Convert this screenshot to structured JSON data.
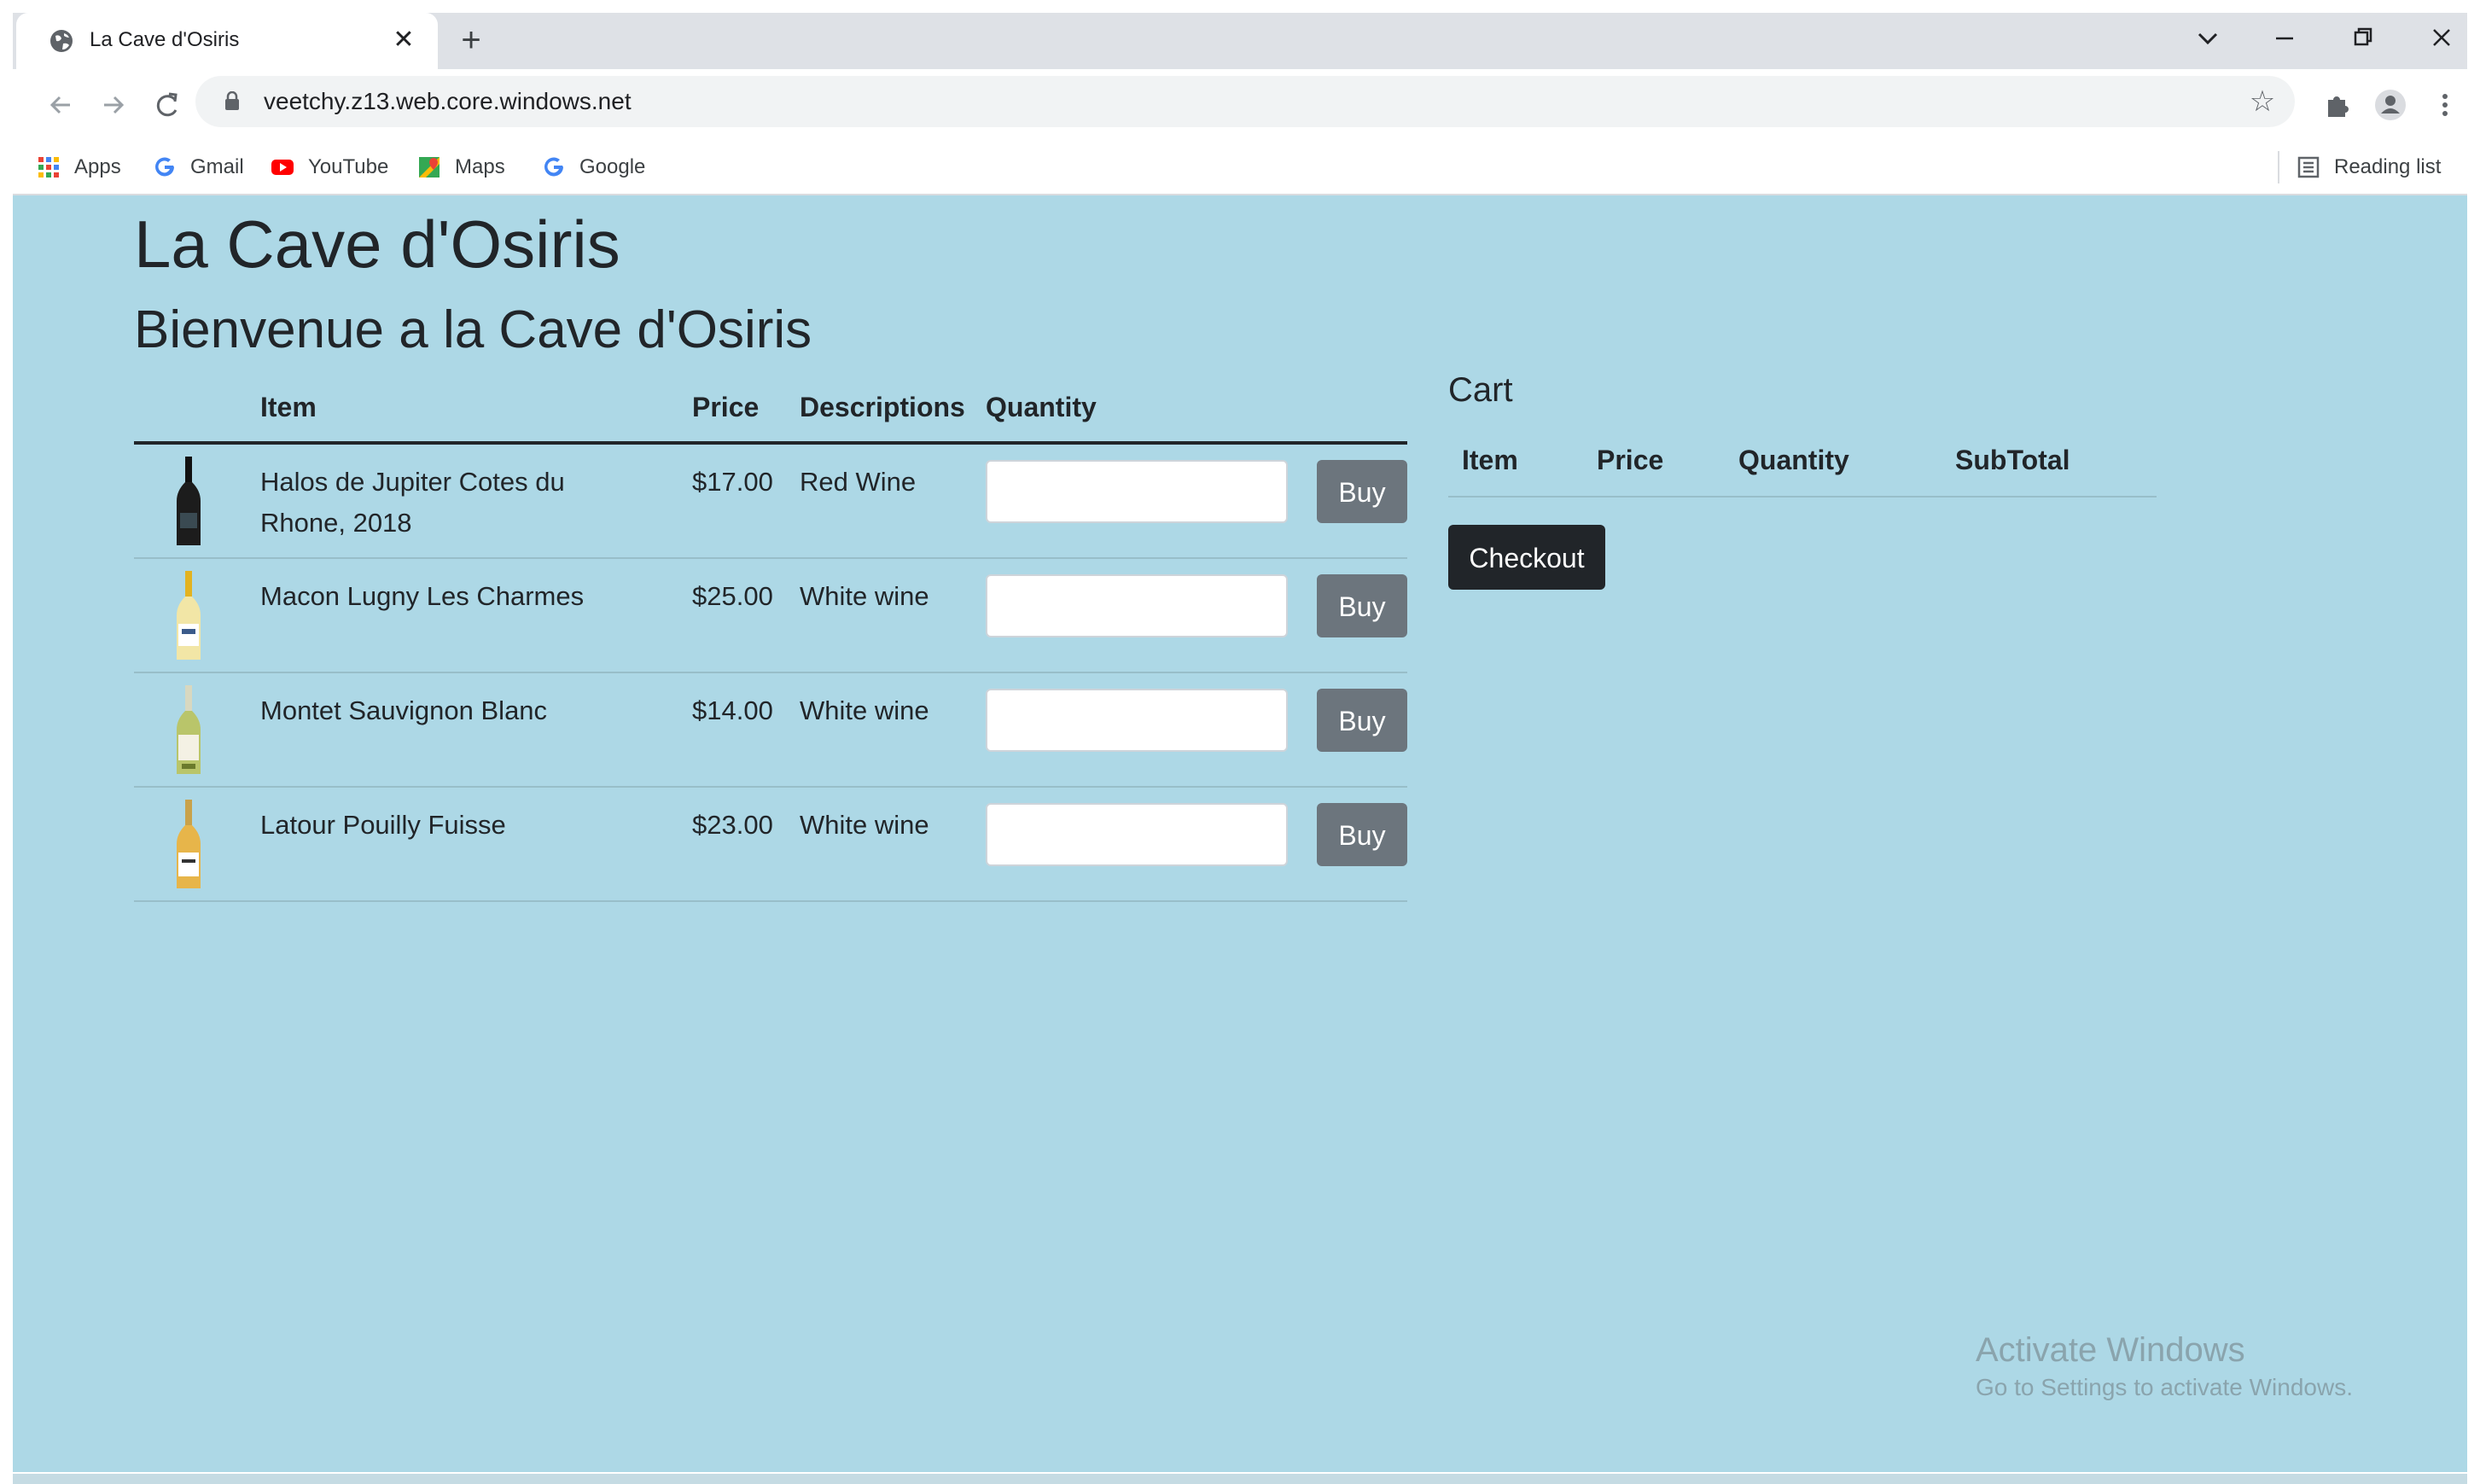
{
  "browser": {
    "tab_title": "La Cave d'Osiris",
    "new_tab": "+",
    "url": "veetchy.z13.web.core.windows.net",
    "bookmarks": [
      "Apps",
      "Gmail",
      "YouTube",
      "Maps",
      "Google"
    ],
    "reading_list": "Reading list",
    "icons": {
      "back": "back-arrow-icon",
      "forward": "forward-arrow-icon",
      "reload": "reload-icon",
      "star": "star-icon",
      "extensions": "puzzle-icon",
      "profile": "profile-icon",
      "menu": "kebab-menu-icon"
    }
  },
  "page": {
    "title": "La Cave d'Osiris",
    "subtitle": "Bienvenue a la Cave d'Osiris",
    "products_table": {
      "headers": {
        "item": "Item",
        "price": "Price",
        "descriptions": "Descriptions",
        "quantity": "Quantity"
      },
      "rows": [
        {
          "name": "Halos de Jupiter Cotes du Rhone, 2018",
          "price": "$17.00",
          "description": "Red Wine",
          "quantity": "",
          "buy": "Buy",
          "bottle": "red"
        },
        {
          "name": "Macon Lugny Les Charmes",
          "price": "$25.00",
          "description": "White wine",
          "quantity": "",
          "buy": "Buy",
          "bottle": "white"
        },
        {
          "name": "Montet Sauvignon Blanc",
          "price": "$14.00",
          "description": "White wine",
          "quantity": "",
          "buy": "Buy",
          "bottle": "white-green"
        },
        {
          "name": "Latour Pouilly Fuisse",
          "price": "$23.00",
          "description": "White wine",
          "quantity": "",
          "buy": "Buy",
          "bottle": "white-gold"
        }
      ]
    },
    "cart": {
      "title": "Cart",
      "headers": {
        "item": "Item",
        "price": "Price",
        "quantity": "Quantity",
        "subtotal": "SubTotal"
      },
      "checkout": "Checkout"
    }
  },
  "os_watermark": {
    "line1": "Activate Windows",
    "line2": "Go to Settings to activate Windows."
  },
  "colors": {
    "page_background": "#add8e6",
    "buy_button": "#6c757d",
    "checkout_button": "#212529"
  }
}
